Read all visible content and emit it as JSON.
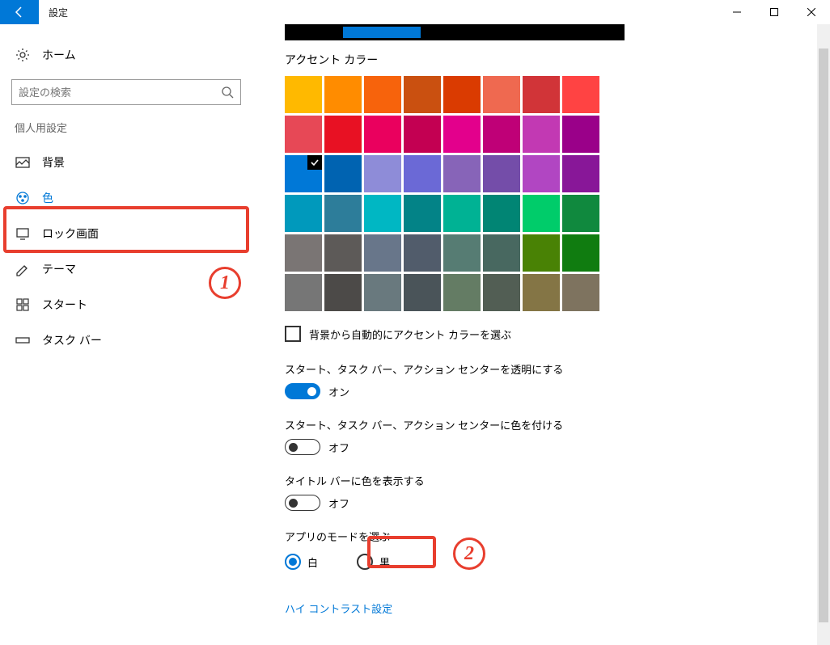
{
  "titlebar": {
    "title": "設定"
  },
  "sidebar": {
    "home": "ホーム",
    "search_placeholder": "設定の検索",
    "section": "個人用設定",
    "items": [
      {
        "key": "background",
        "label": "背景"
      },
      {
        "key": "color",
        "label": "色"
      },
      {
        "key": "lockscreen",
        "label": "ロック画面"
      },
      {
        "key": "theme",
        "label": "テーマ"
      },
      {
        "key": "start",
        "label": "スタート"
      },
      {
        "key": "taskbar",
        "label": "タスク バー"
      }
    ]
  },
  "content": {
    "accent_title": "アクセント カラー",
    "auto_pick": "背景から自動的にアクセント カラーを選ぶ",
    "transparent": {
      "label": "スタート、タスク バー、アクション センターを透明にする",
      "state": "オン"
    },
    "colorize_start": {
      "label": "スタート、タスク バー、アクション センターに色を付ける",
      "state": "オフ"
    },
    "titlebar_color": {
      "label": "タイトル バーに色を表示する",
      "state": "オフ"
    },
    "app_mode": {
      "label": "アプリのモードを選ぶ",
      "light": "白",
      "dark": "黒"
    },
    "high_contrast": "ハイ コントラスト設定"
  },
  "colors": [
    "#ffb900",
    "#ff8c00",
    "#f7630c",
    "#ca5010",
    "#da3b01",
    "#ef6950",
    "#d13438",
    "#ff4343",
    "#e74856",
    "#e81123",
    "#ea005e",
    "#c30052",
    "#e3008c",
    "#bf0077",
    "#c239b3",
    "#9a0089",
    "#0078d7",
    "#0063b1",
    "#8e8cd8",
    "#6b69d6",
    "#8764b8",
    "#744da9",
    "#b146c2",
    "#881798",
    "#0099bc",
    "#2d7d9a",
    "#00b7c3",
    "#038387",
    "#00b294",
    "#018574",
    "#00cc6a",
    "#10893e",
    "#7a7574",
    "#5d5a58",
    "#68768a",
    "#515c6b",
    "#567c73",
    "#486860",
    "#498205",
    "#107c10",
    "#767676",
    "#4c4a48",
    "#69797e",
    "#4a5459",
    "#647c64",
    "#525e54",
    "#847545",
    "#7e735f"
  ],
  "selected_color_index": 16,
  "annotations": {
    "one": "1",
    "two": "2"
  }
}
